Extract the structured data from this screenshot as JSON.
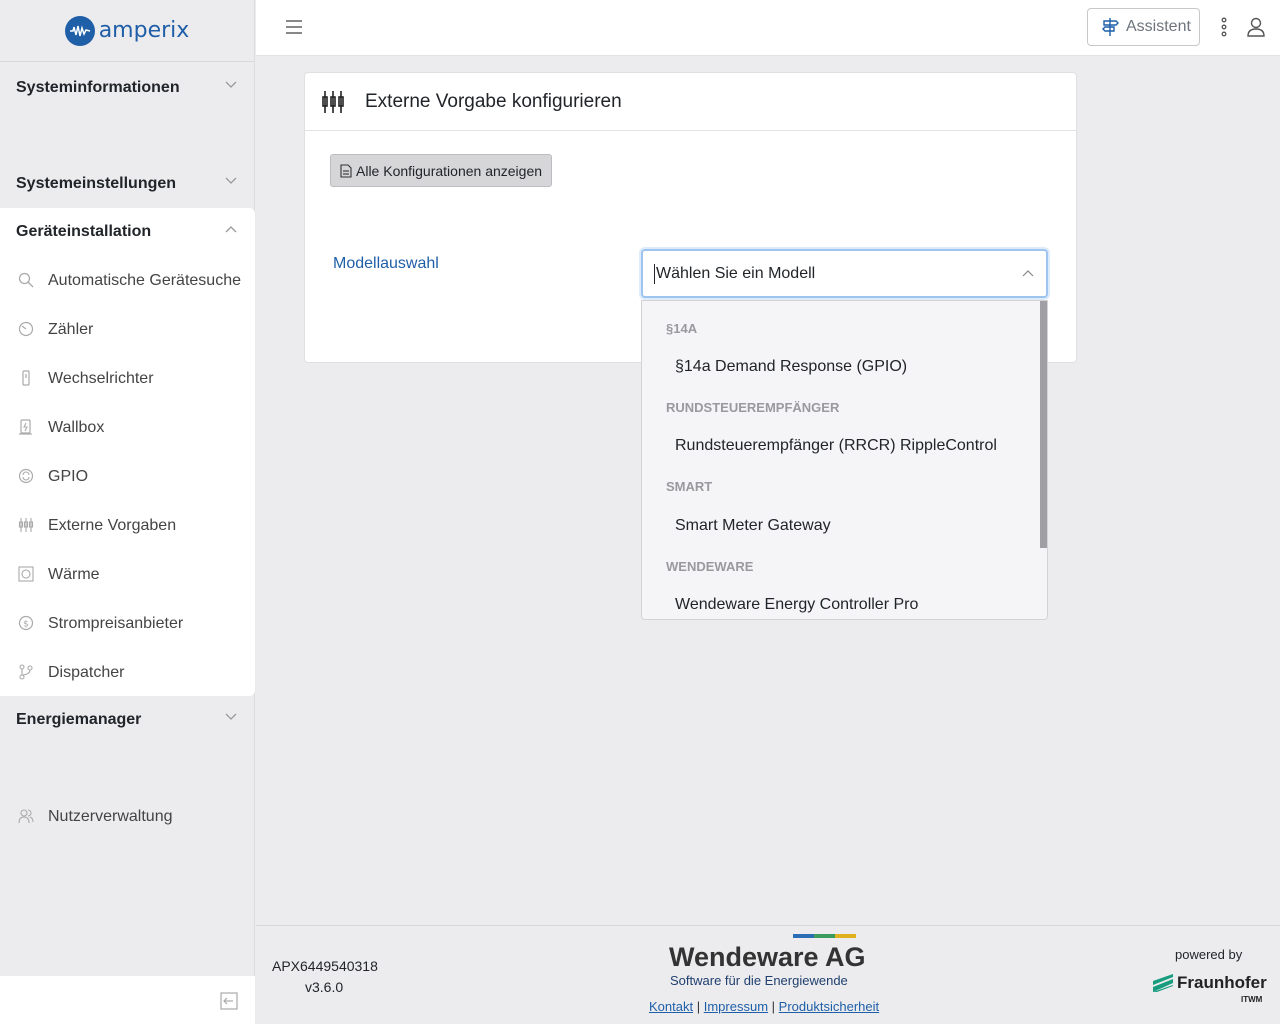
{
  "app": {
    "logo_text": "amperix",
    "brand_color": "#1f5fa8"
  },
  "sidebar": {
    "sections": [
      {
        "label": "Systeminformationen",
        "expanded": false
      },
      {
        "label": "Systemeinstellungen",
        "expanded": false
      },
      {
        "label": "Geräteinstallation",
        "expanded": true
      },
      {
        "label": "Energiemanager",
        "expanded": false
      }
    ],
    "items": [
      {
        "label": "Automatische Gerätesuche",
        "icon": "search-icon"
      },
      {
        "label": "Zähler",
        "icon": "meter-icon"
      },
      {
        "label": "Wechselrichter",
        "icon": "inverter-icon"
      },
      {
        "label": "Wallbox",
        "icon": "wallbox-icon"
      },
      {
        "label": "GPIO",
        "icon": "gpio-icon"
      },
      {
        "label": "Externe Vorgaben",
        "icon": "sliders-icon"
      },
      {
        "label": "Wärme",
        "icon": "heat-icon"
      },
      {
        "label": "Strompreisanbieter",
        "icon": "dollar-icon"
      },
      {
        "label": "Dispatcher",
        "icon": "branch-icon"
      }
    ],
    "user_item": {
      "label": "Nutzerverwaltung",
      "icon": "users-icon"
    }
  },
  "topbar": {
    "assistant_label": "Assistent"
  },
  "card": {
    "title": "Externe Vorgabe konfigurieren",
    "show_all_label": "Alle Konfigurationen anzeigen",
    "model_label": "Modellauswahl",
    "select_placeholder": "Wählen Sie ein Modell"
  },
  "dropdown": {
    "groups": [
      {
        "label": "§14A",
        "options": [
          "§14a Demand Response (GPIO)"
        ]
      },
      {
        "label": "RUNDSTEUEREMPFÄNGER",
        "options": [
          "Rundsteuerempfänger (RRCR) RippleControl"
        ]
      },
      {
        "label": "SMART",
        "options": [
          "Smart Meter Gateway"
        ]
      },
      {
        "label": "WENDEWARE",
        "options": [
          "Wendeware Energy Controller Pro"
        ]
      }
    ]
  },
  "footer": {
    "serial": "APX6449540318",
    "version": "v3.6.0",
    "company": "Wendeware AG",
    "tagline": "Software für die Energiewende",
    "links": [
      "Kontakt",
      "Impressum",
      "Produktsicherheit"
    ],
    "separator": "|",
    "powered_by": "powered by",
    "partner": "Fraunhofer",
    "partner_unit": "ITWM",
    "stripe_colors": [
      "#2a6db5",
      "#3a9b5b",
      "#e0b020"
    ]
  }
}
